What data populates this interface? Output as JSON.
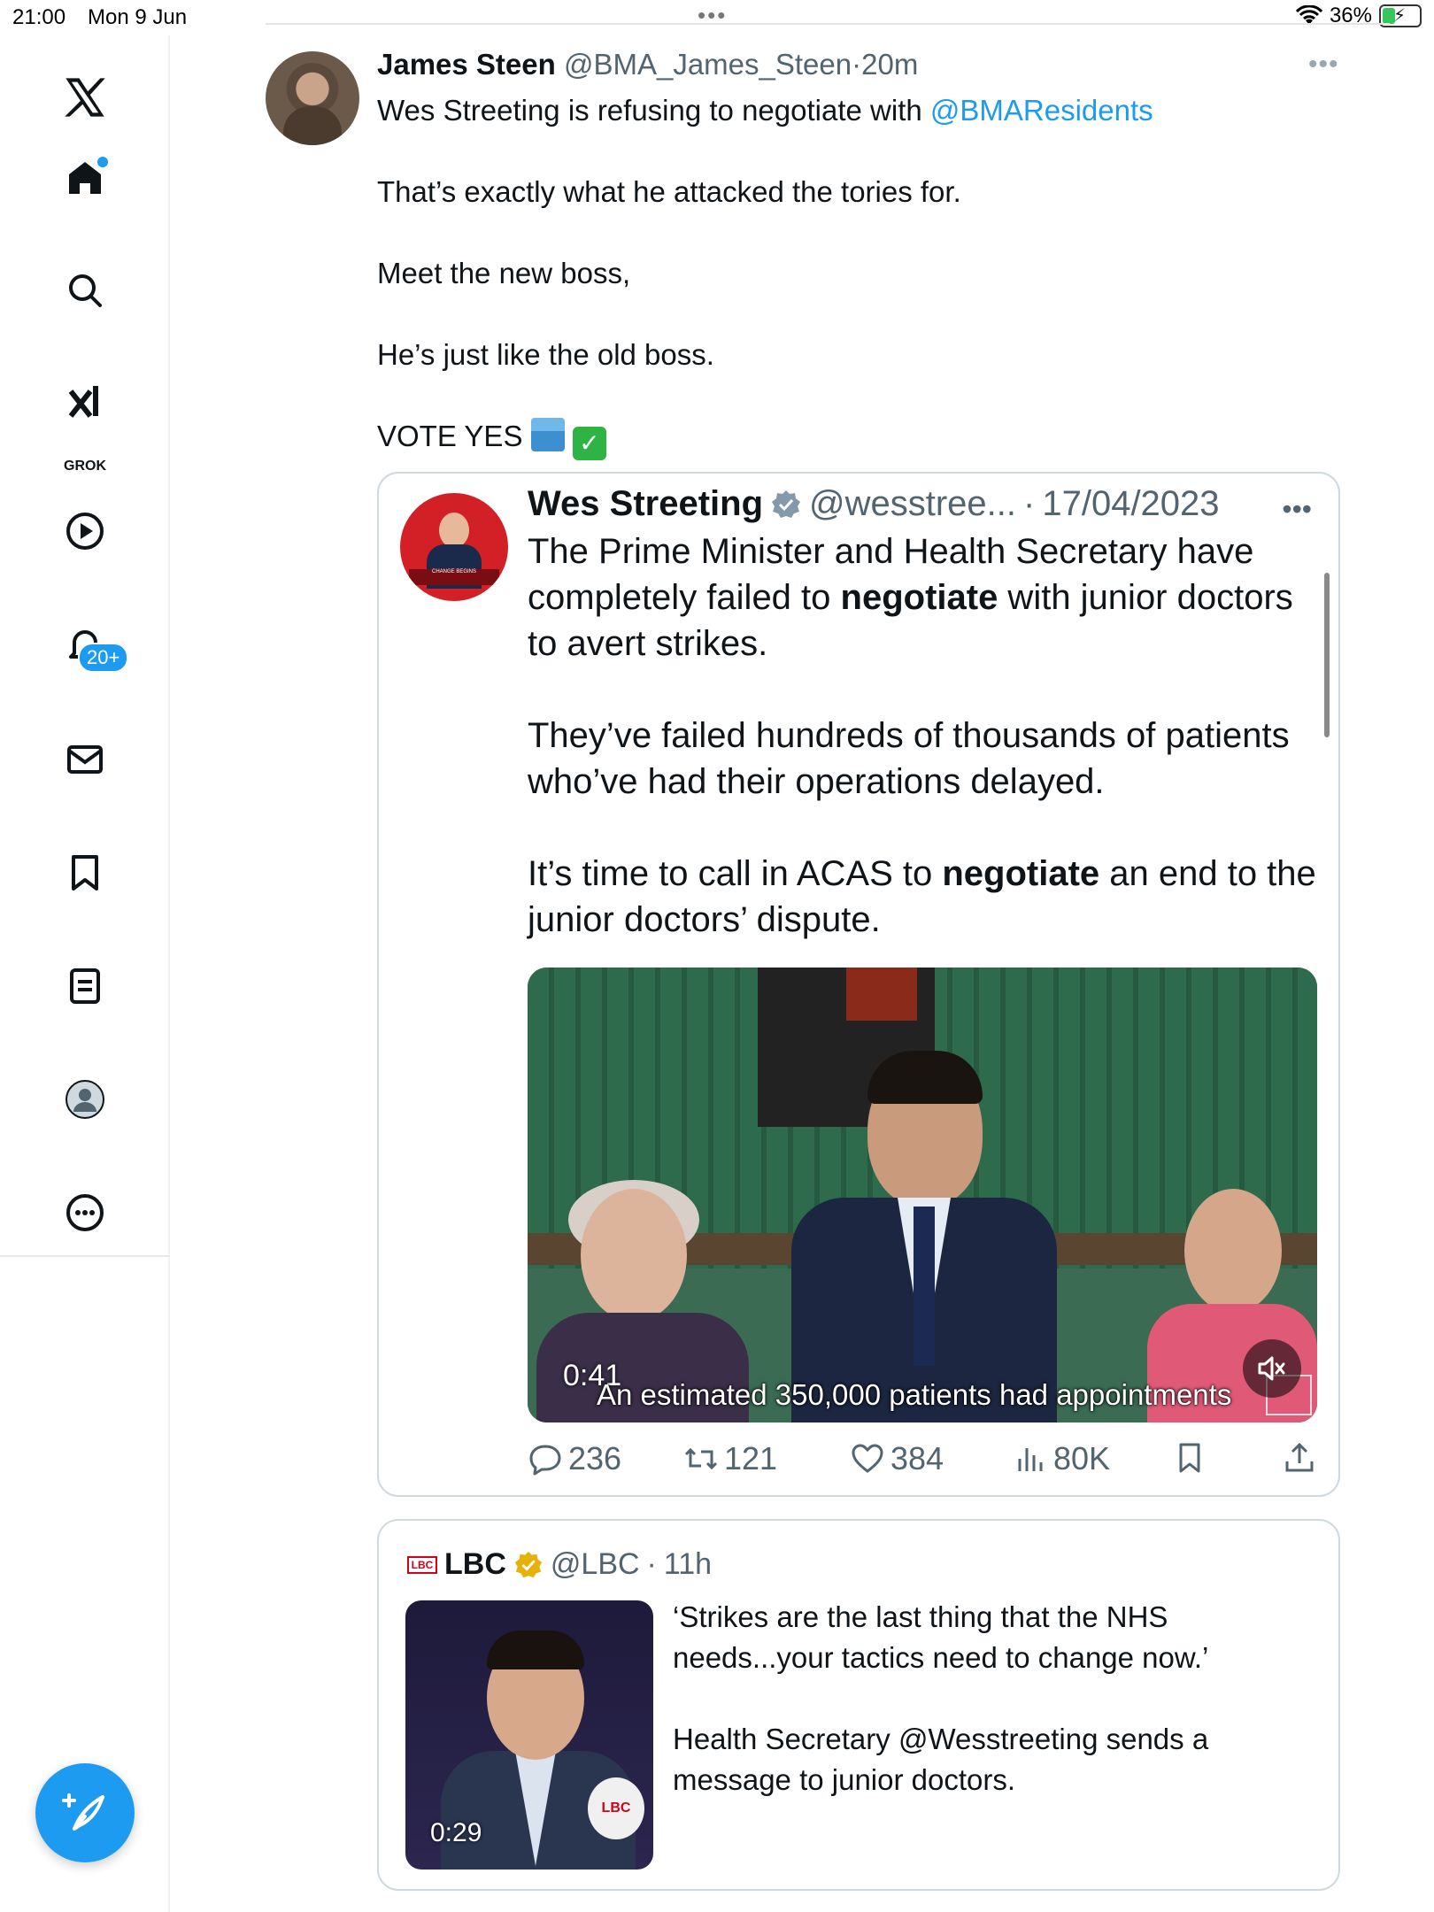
{
  "status_bar": {
    "time": "21:00",
    "date": "Mon 9 Jun",
    "battery": "36%",
    "multitask_dots": "•••"
  },
  "sidebar": {
    "items": [
      {
        "name": "x-logo",
        "icon": "x-icon"
      },
      {
        "name": "home",
        "icon": "home-icon"
      },
      {
        "name": "explore",
        "icon": "search-icon"
      },
      {
        "name": "grok",
        "icon": "grok-icon",
        "label": "GROK"
      },
      {
        "name": "videos",
        "icon": "play-icon"
      },
      {
        "name": "notifications",
        "icon": "bell-icon",
        "badge": "20+"
      },
      {
        "name": "messages",
        "icon": "mail-icon"
      },
      {
        "name": "bookmarks",
        "icon": "bookmark-icon"
      },
      {
        "name": "lists",
        "icon": "list-icon"
      },
      {
        "name": "profile",
        "icon": "profile-icon"
      },
      {
        "name": "more",
        "icon": "more-icon"
      }
    ],
    "compose_icon": "compose-icon"
  },
  "tweet": {
    "author_name": "James Steen",
    "author_handle": "@BMA_James_Steen",
    "separator": "·",
    "time": "20m",
    "more": "•••",
    "line1_prefix": "Wes Streeting is refusing to negotiate with ",
    "mention": "@BMAResidents",
    "line2": "That’s exactly what he attacked the tories for.",
    "line3": "Meet the new boss,",
    "line4": "He’s just like the old boss.",
    "line5": "VOTE YES",
    "emoji1": "ballot-box-icon",
    "emoji2": "check-mark-icon",
    "check_glyph": "✓"
  },
  "quote": {
    "author_name": "Wes Streeting",
    "author_handle": "@wesstree...",
    "separator": "·",
    "date": "17/04/2023",
    "more": "•••",
    "avatar_banner": "CHANGE BEGINS",
    "p1_a": "The Prime Minister and Health Secretary have completely failed to ",
    "p1_bold": "negotiate",
    "p1_b": " with junior doctors to avert strikes.",
    "p2": "They’ve failed hundreds of thousands of patients who’ve had their operations delayed.",
    "p3_a": "It’s time to call in ACAS to ",
    "p3_bold": "negotiate",
    "p3_b": " an end to the junior doctors’ dispute.",
    "video": {
      "time": "0:41",
      "caption": "An estimated 350,000 patients had appointments",
      "mute_icon": "muted-speaker-icon"
    },
    "actions": {
      "replies": "236",
      "reposts": "121",
      "likes": "384",
      "views": "80K"
    }
  },
  "lbc": {
    "logo_text": "LBC",
    "author_name": "LBC",
    "author_handle": "@LBC",
    "separator": "·",
    "time": "11h",
    "video_time": "0:29",
    "mic_text": "LBC",
    "p1": "‘Strikes are the last thing that the NHS needs...your tactics need to change now.’",
    "p2": "Health Secretary @Wesstreeting sends a message to junior doctors."
  },
  "colors": {
    "accent": "#1d9bf0",
    "text": "#0f1419",
    "secondary": "#536471",
    "border": "#cfd9de",
    "verified_blue": "#1d9bf0",
    "verified_gold": "#e8b10a"
  }
}
